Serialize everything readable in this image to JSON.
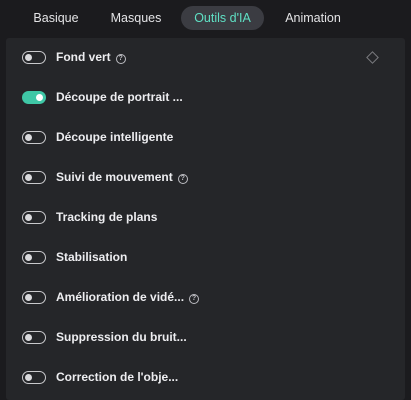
{
  "tabs": [
    {
      "label": "Basique",
      "active": false
    },
    {
      "label": "Masques",
      "active": false
    },
    {
      "label": "Outils d'IA",
      "active": true
    },
    {
      "label": "Animation",
      "active": false
    }
  ],
  "accent_color": "#3fc7a6",
  "help_glyph": "?",
  "features": [
    {
      "label": "Fond vert",
      "enabled": false,
      "help_icon": true,
      "keyframe_icon": true
    },
    {
      "label": "Découpe de portrait ...",
      "enabled": true,
      "help_icon": false,
      "keyframe_icon": false
    },
    {
      "label": "Découpe intelligente",
      "enabled": false,
      "help_icon": false,
      "keyframe_icon": false
    },
    {
      "label": "Suivi de mouvement",
      "enabled": false,
      "help_icon": true,
      "keyframe_icon": false
    },
    {
      "label": "Tracking de plans",
      "enabled": false,
      "help_icon": false,
      "keyframe_icon": false
    },
    {
      "label": "Stabilisation",
      "enabled": false,
      "help_icon": false,
      "keyframe_icon": false
    },
    {
      "label": "Amélioration de vidé...",
      "enabled": false,
      "help_icon": true,
      "keyframe_icon": false
    },
    {
      "label": "Suppression du bruit...",
      "enabled": false,
      "help_icon": false,
      "keyframe_icon": false
    },
    {
      "label": "Correction de l'obje...",
      "enabled": false,
      "help_icon": false,
      "keyframe_icon": false
    }
  ]
}
